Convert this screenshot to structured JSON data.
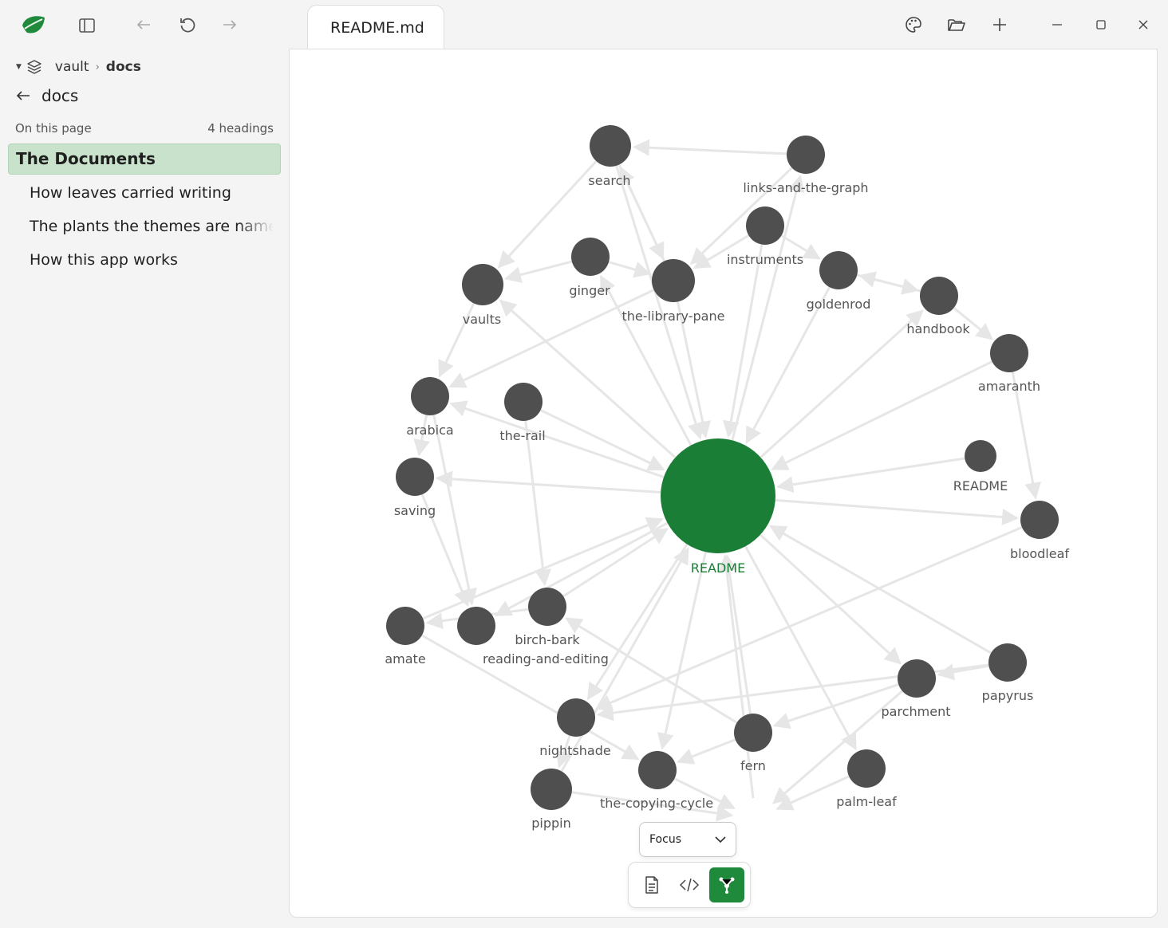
{
  "titlebar": {
    "tab_title": "README.md",
    "icons": [
      "leaf-logo-icon",
      "sidebar-toggle-icon",
      "back-arrow-icon",
      "refresh-icon",
      "forward-arrow-icon",
      "palette-icon",
      "folder-open-icon",
      "plus-icon",
      "minimize-icon",
      "maximize-icon",
      "close-icon"
    ]
  },
  "sidebar": {
    "breadcrumb": {
      "vault": "vault",
      "folder": "docs"
    },
    "back_label": "docs",
    "on_this_page": "On this page",
    "headings_count": "4 headings",
    "headings": [
      {
        "label": "The Documents",
        "active": true
      },
      {
        "label": "How leaves carried writing"
      },
      {
        "label": "The plants the themes are named"
      },
      {
        "label": "How this app works"
      }
    ]
  },
  "graph": {
    "center": {
      "label": "README",
      "color": "#1b7e36"
    },
    "node_color": "#4f4f4f",
    "edge_color": "#e6e6e6",
    "nodes": [
      {
        "label": "search"
      },
      {
        "label": "links-and-the-graph"
      },
      {
        "label": "instruments"
      },
      {
        "label": "ginger"
      },
      {
        "label": "the-library-pane"
      },
      {
        "label": "vaults"
      },
      {
        "label": "goldenrod"
      },
      {
        "label": "handbook"
      },
      {
        "label": "amaranth"
      },
      {
        "label": "arabica"
      },
      {
        "label": "the-rail"
      },
      {
        "label": "saving"
      },
      {
        "label": "README"
      },
      {
        "label": "bloodleaf"
      },
      {
        "label": "amate"
      },
      {
        "label": "reading-and-editing"
      },
      {
        "label": "birch-bark"
      },
      {
        "label": "nightshade"
      },
      {
        "label": "papyrus"
      },
      {
        "label": "parchment"
      },
      {
        "label": "fern"
      },
      {
        "label": "the-copying-cycle"
      },
      {
        "label": "pippin"
      },
      {
        "label": "palm-leaf"
      }
    ]
  },
  "controls": {
    "mode_select": "Focus",
    "views": [
      "document-icon",
      "code-icon",
      "graph-icon"
    ],
    "active_view": "graph-icon"
  }
}
